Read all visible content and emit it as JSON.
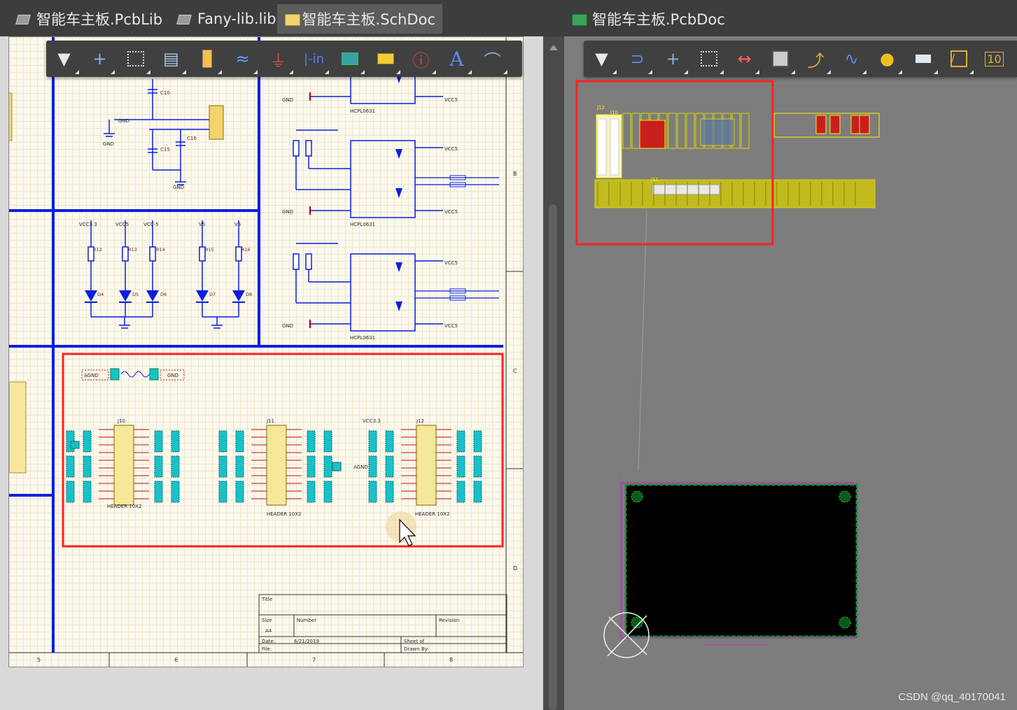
{
  "tabs": [
    {
      "label": "智能车主板.PcbLib",
      "icon": "pcblib-icon"
    },
    {
      "label": "Fany-lib.lib",
      "icon": "schlib-icon"
    },
    {
      "label": "智能车主板.SchDoc",
      "icon": "schdoc-icon",
      "active": true
    },
    {
      "label": "智能车主板.PcbDoc",
      "icon": "pcbdoc-icon"
    }
  ],
  "sch_toolbar": [
    "filter",
    "cross",
    "select-rect",
    "align",
    "component",
    "bus",
    "ground",
    "port",
    "harness",
    "net-label",
    "parameter",
    "text",
    "arc"
  ],
  "pcb_toolbar": [
    "filter",
    "interactive-route",
    "cross",
    "select-rect",
    "dimension",
    "component",
    "route",
    "diff-pair",
    "via",
    "fill",
    "line",
    "string"
  ],
  "schematic": {
    "power_labels": [
      "VCC3.3",
      "VCC5",
      "VCC-5",
      "V5",
      "V5"
    ],
    "resistors": [
      "R12",
      "R13",
      "R14",
      "R15",
      "R16"
    ],
    "leds": [
      "D4",
      "D5",
      "D6",
      "D7",
      "D8"
    ],
    "opto_chips": [
      "HCPL0631",
      "HCPL0631",
      "HCPL0631"
    ],
    "net_labels": [
      "GND",
      "VCC5",
      "VCC5",
      "VCC5",
      "GND",
      "AGND",
      "GND",
      "AGND",
      "VCC3.3"
    ],
    "connectors": [
      "J10",
      "J11",
      "J12"
    ],
    "header_label": "HEADER 10X2",
    "cap_labels": [
      "C10",
      "C15",
      "C16"
    ],
    "bottom_ruler": [
      "5",
      "6",
      "7",
      "8"
    ],
    "side_ruler": [
      "B",
      "C",
      "D"
    ],
    "title_block": {
      "title": "Title",
      "size": "Size",
      "size_val": "A4",
      "number": "Number",
      "revision": "Revision",
      "date": "Date:",
      "date_val": "6/21/2019",
      "sheet": "Sheet   of",
      "file": "File:",
      "drawn": "Drawn By:"
    }
  },
  "pcb": {
    "component_labels": [
      "J12",
      "J10",
      "J11"
    ]
  },
  "watermark": "CSDN @qq_40170041",
  "colors": {
    "highlight": "#ff2020",
    "wire": "#0a1fe0",
    "pad": "#18c1c8",
    "silk": "#e8e000",
    "board": "#000000"
  }
}
